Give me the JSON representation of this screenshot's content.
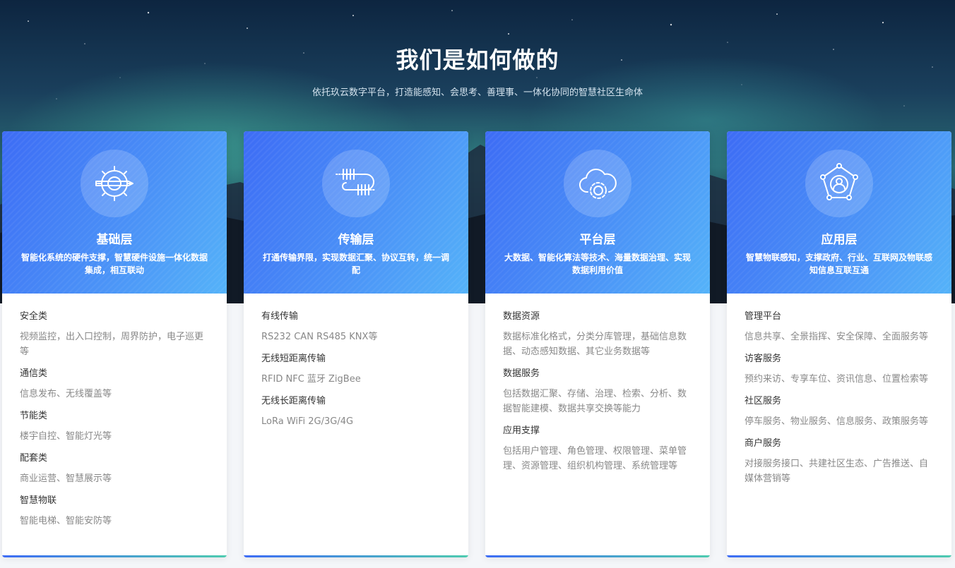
{
  "header": {
    "title": "我们是如何做的",
    "subtitle": "依托玖云数字平台，打造能感知、会思考、善理事、一体化协同的智慧社区生命体"
  },
  "colors": {
    "accent_blue": "#3d6cf5",
    "accent_light_blue": "#55b3f9",
    "accent_green": "#4ecbb0",
    "text_dark": "#333333",
    "text_gray": "#888888"
  },
  "cards": [
    {
      "icon": "gear-pencil-icon",
      "title": "基础层",
      "desc": "智能化系统的硬件支撑，智慧硬件设施一体化数据集成，相互联动",
      "sections": [
        {
          "title": "安全类",
          "text": "视频监控，出入口控制，周界防护，电子巡更等"
        },
        {
          "title": "通信类",
          "text": "信息发布、无线覆盖等"
        },
        {
          "title": "节能类",
          "text": "楼宇自控、智能灯光等"
        },
        {
          "title": "配套类",
          "text": "商业运营、智慧展示等"
        },
        {
          "title": "智慧物联",
          "text": "智能电梯、智能安防等"
        }
      ]
    },
    {
      "icon": "coil-transmission-icon",
      "title": "传输层",
      "desc": "打通传输界限，实现数据汇聚、协议互转，统一调配",
      "sections": [
        {
          "title": "有线传输",
          "text": "RS232 CAN RS485 KNX等"
        },
        {
          "title": "无线短距离传输",
          "text": "RFID NFC 蓝牙 ZigBee"
        },
        {
          "title": "无线长距离传输",
          "text": "LoRa WiFi 2G/3G/4G"
        }
      ]
    },
    {
      "icon": "cloud-gear-icon",
      "title": "平台层",
      "desc": "大数据、智能化算法等技术、海量数据治理、实现数据利用价值",
      "sections": [
        {
          "title": "数据资源",
          "text": "数据标准化格式，分类分库管理，基础信息数据、动态感知数据、其它业务数据等"
        },
        {
          "title": "数据服务",
          "text": "包括数据汇聚、存储、治理、检索、分析、数据智能建模、数据共享交换等能力"
        },
        {
          "title": "应用支撑",
          "text": "包括用户管理、角色管理、权限管理、菜单管理、资源管理、组织机构管理、系统管理等"
        }
      ]
    },
    {
      "icon": "user-network-icon",
      "title": "应用层",
      "desc": "智慧物联感知，支撑政府、行业、互联网及物联感知信息互联互通",
      "sections": [
        {
          "title": "管理平台",
          "text": "信息共享、全景指挥、安全保障、全面服务等"
        },
        {
          "title": "访客服务",
          "text": "预约来访、专享车位、资讯信息、位置检索等"
        },
        {
          "title": "社区服务",
          "text": "停车服务、物业服务、信息服务、政策服务等"
        },
        {
          "title": "商户服务",
          "text": "对接服务接口、共建社区生态、广告推送、自媒体营销等"
        }
      ]
    }
  ]
}
